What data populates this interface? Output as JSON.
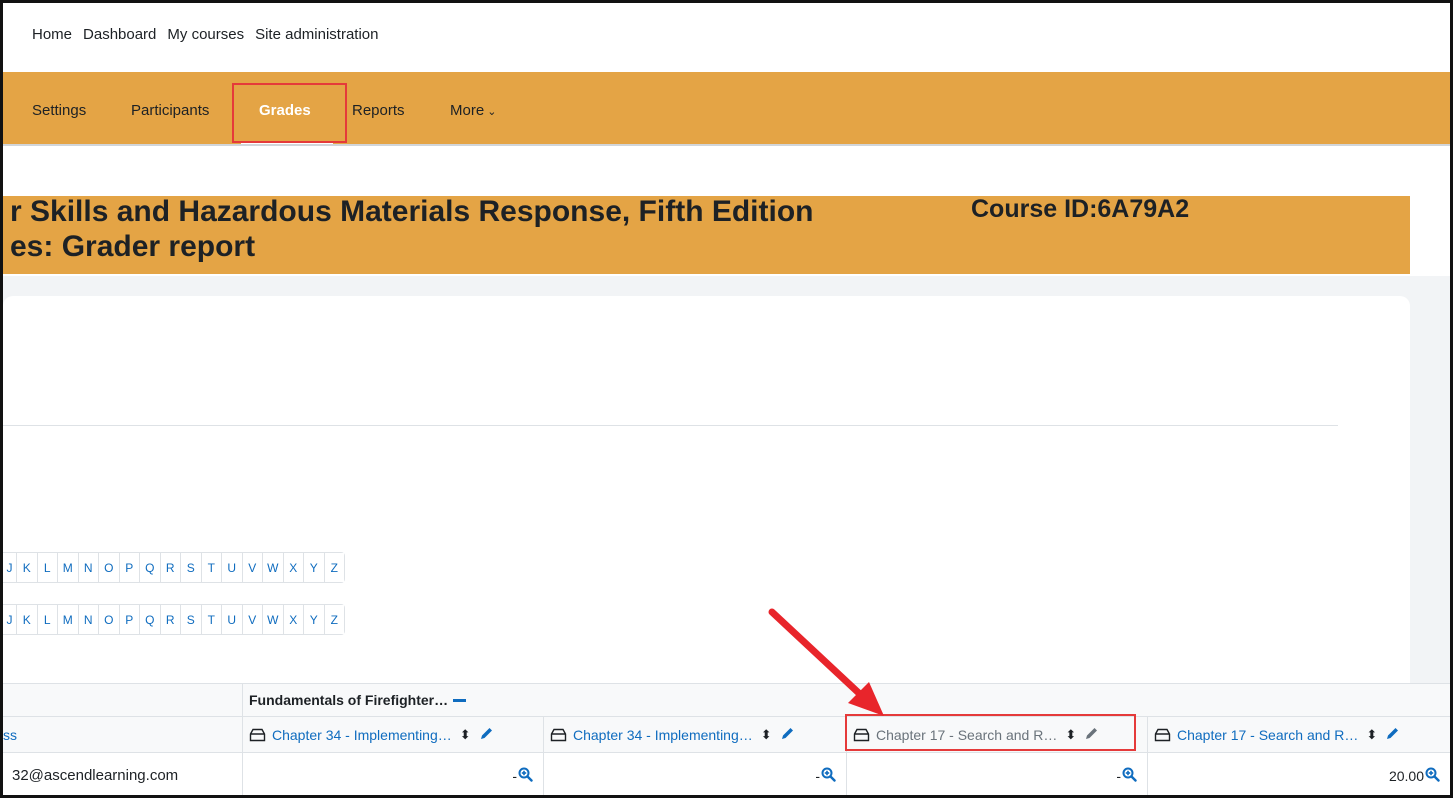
{
  "topnav": {
    "items": [
      "Home",
      "Dashboard",
      "My courses",
      "Site administration"
    ]
  },
  "secnav": {
    "tabs": [
      "Settings",
      "Participants",
      "Grades",
      "Reports",
      "More"
    ],
    "active": "Grades"
  },
  "header": {
    "course_title_line": "r Skills and Hazardous Materials Response, Fifth Edition",
    "page_title_line": "es: Grader report",
    "course_id": "Course ID:6A79A2"
  },
  "letterbars": {
    "first_name_letters": [
      "J",
      "K",
      "L",
      "M",
      "N",
      "O",
      "P",
      "Q",
      "R",
      "S",
      "T",
      "U",
      "V",
      "W",
      "X",
      "Y",
      "Z"
    ],
    "last_name_letters": [
      "J",
      "K",
      "L",
      "M",
      "N",
      "O",
      "P",
      "Q",
      "R",
      "S",
      "T",
      "U",
      "V",
      "W",
      "X",
      "Y",
      "Z"
    ]
  },
  "grade_table": {
    "category": "Fundamentals of Firefighter…",
    "user_column_header": "ss",
    "items": [
      {
        "label": "Chapter 34 - Implementing…",
        "hidden": false
      },
      {
        "label": "Chapter 34 - Implementing…",
        "hidden": false
      },
      {
        "label": "Chapter 17 - Search and R…",
        "hidden": true
      },
      {
        "label": "Chapter 17 - Search and R…",
        "hidden": false
      }
    ],
    "user_email": "32@ascendlearning.com",
    "grades": [
      "-",
      "-",
      "-",
      "20.00"
    ]
  },
  "colors": {
    "brand_orange": "#e4a445",
    "link_blue": "#0f6cbf",
    "highlight_red": "#e53a3a"
  },
  "icons": {
    "item_type": "assignment-icon",
    "sort": "sort-icon",
    "edit": "pencil-icon",
    "zoom": "zoom-in-icon"
  }
}
